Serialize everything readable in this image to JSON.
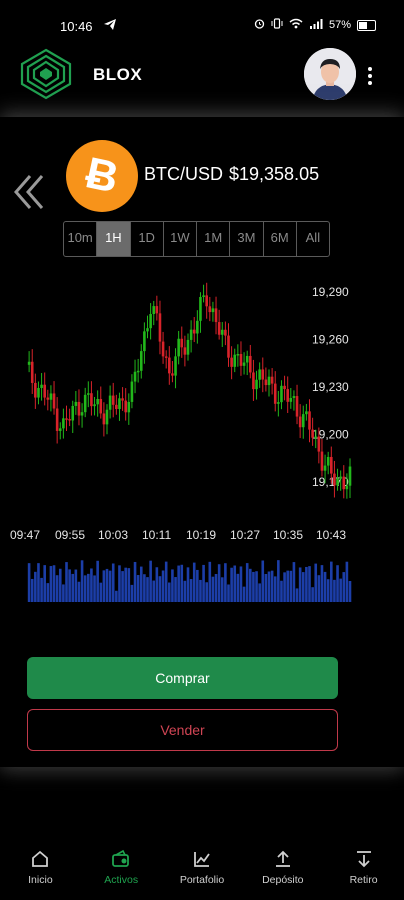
{
  "status_bar": {
    "time": "10:46",
    "battery": "57%"
  },
  "header": {
    "brand": "BLOX"
  },
  "asset": {
    "pair": "BTC/USD",
    "price": "$19,358.05"
  },
  "ranges": [
    {
      "label": "10m",
      "active": false
    },
    {
      "label": "1H",
      "active": true
    },
    {
      "label": "1D",
      "active": false
    },
    {
      "label": "1W",
      "active": false
    },
    {
      "label": "1M",
      "active": false
    },
    {
      "label": "3M",
      "active": false
    },
    {
      "label": "6M",
      "active": false
    },
    {
      "label": "All",
      "active": false
    }
  ],
  "chart_data": {
    "type": "candlestick",
    "y_ticks": [
      "19,290",
      "19,260",
      "19,230",
      "19,200",
      "19,170"
    ],
    "x_ticks": [
      "09:47",
      "09:55",
      "10:03",
      "10:11",
      "10:19",
      "10:27",
      "10:35",
      "10:43"
    ],
    "ylim": [
      19150,
      19305
    ],
    "up_color": "#22b81b",
    "down_color": "#d8232a",
    "volume_color": "#1c3ea8"
  },
  "actions": {
    "buy": "Comprar",
    "sell": "Vender"
  },
  "nav": {
    "items": [
      {
        "label": "Inicio",
        "icon": "home-icon"
      },
      {
        "label": "Activos",
        "icon": "wallet-icon"
      },
      {
        "label": "Portafolio",
        "icon": "chart-icon"
      },
      {
        "label": "Depósito",
        "icon": "upload-icon"
      },
      {
        "label": "Retiro",
        "icon": "download-icon"
      }
    ]
  }
}
